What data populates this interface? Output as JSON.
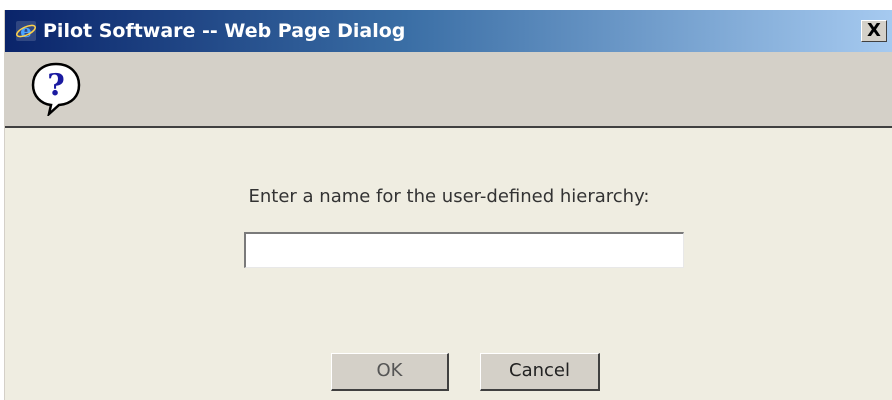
{
  "window": {
    "title": "Pilot Software -- Web Page Dialog",
    "close_label": "X",
    "title_icon": "ie-icon"
  },
  "header": {
    "icon": "question-balloon-icon"
  },
  "dialog": {
    "prompt": "Enter a name for the user-defined hierarchy:",
    "input_value": "",
    "input_placeholder": "",
    "ok_label": "OK",
    "cancel_label": "Cancel"
  },
  "colors": {
    "titlebar_start": "#0a246a",
    "titlebar_end": "#a6caf0",
    "dialog_bg": "#efede1",
    "button_face": "#d4d0c8"
  }
}
